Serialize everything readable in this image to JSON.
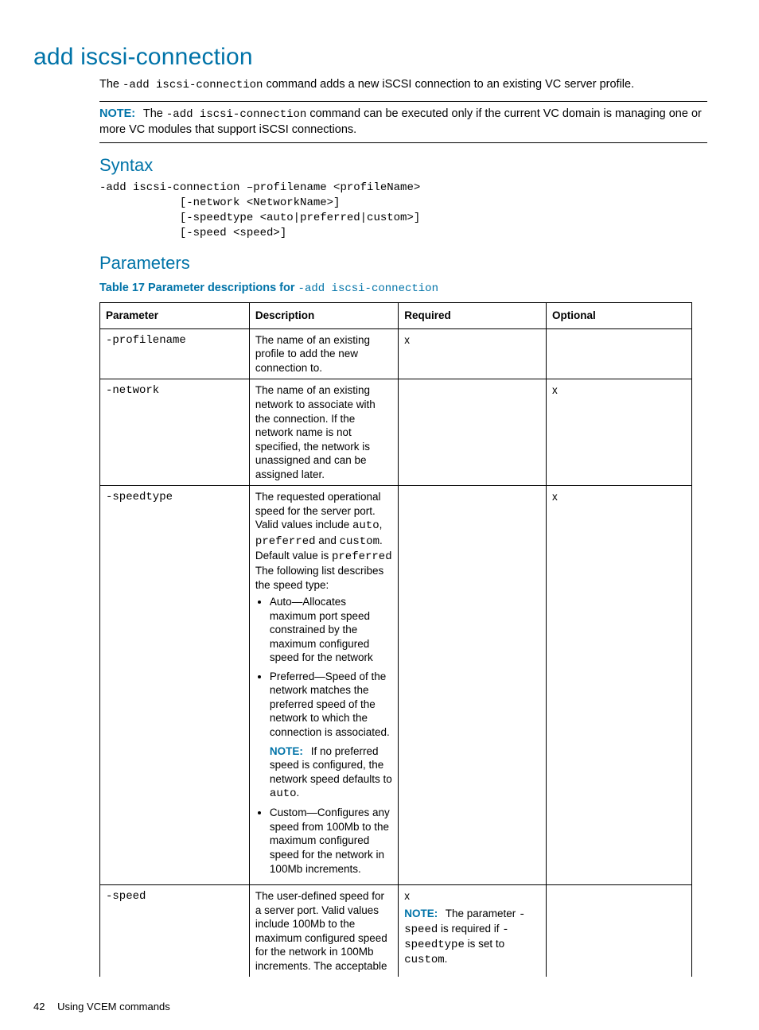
{
  "title": "add iscsi-connection",
  "intro_pre": "The ",
  "intro_code": "-add iscsi-connection",
  "intro_post": " command adds a new iSCSI connection to an existing VC server profile.",
  "note": {
    "label": "NOTE:",
    "pre": "The ",
    "code": "-add iscsi-connection",
    "post": " command can be executed only if the current VC domain is managing one or more VC modules that support iSCSI connections."
  },
  "syntax": {
    "heading": "Syntax",
    "lines": "-add iscsi-connection –profilename <profileName>\n            [-network <NetworkName>]\n            [-speedtype <auto|preferred|custom>]\n            [-speed <speed>]"
  },
  "parameters": {
    "heading": "Parameters",
    "caption_pre": "Table 17 Parameter descriptions for ",
    "caption_code": "-add iscsi-connection",
    "headers": {
      "parameter": "Parameter",
      "description": "Description",
      "required": "Required",
      "optional": "Optional"
    },
    "rows": {
      "profilename": {
        "param": "-profilename",
        "desc": "The name of an existing profile to add the new connection to.",
        "required": "x",
        "optional": ""
      },
      "network": {
        "param": "-network",
        "desc": "The name of an existing network to associate with the connection. If the network name is not specified, the network is unassigned and can be assigned later.",
        "required": "",
        "optional": "x"
      },
      "speedtype": {
        "param": "-speedtype",
        "desc_intro_pre": "The requested operational speed for the server port. Valid values include ",
        "desc_intro_codes_auto": "auto",
        "desc_intro_sep1": ", ",
        "desc_intro_codes_preferred": "preferred",
        "desc_intro_sep2": " and ",
        "desc_intro_codes_custom": "custom",
        "desc_intro_post1": ". Default value is ",
        "desc_default_code": "preferred",
        "desc_intro_post2": " The following list describes the speed type:",
        "bullets": {
          "auto": "Auto—Allocates maximum port speed constrained by the maximum configured speed for the network",
          "preferred": "Preferred—Speed of the network matches the preferred speed of the network to which the connection is associated.",
          "preferred_note_label": "NOTE:",
          "preferred_note_pre": "If no preferred speed is configured, the network speed defaults to ",
          "preferred_note_code": "auto",
          "preferred_note_post": ".",
          "custom": "Custom—Configures any speed from 100Mb to the maximum configured speed for the network in 100Mb increments."
        },
        "required": "",
        "optional": "x"
      },
      "speed": {
        "param": "-speed",
        "desc": "The user-defined speed for a server port. Valid values include 100Mb to the maximum configured speed for the network in 100Mb increments. The acceptable",
        "required": "x",
        "req_note_label": "NOTE:",
        "req_note_pre": "The parameter ",
        "req_note_code1": "-speed",
        "req_note_mid": " is required if ",
        "req_note_code2": "-speedtype",
        "req_note_mid2": " is set to ",
        "req_note_code3": "custom",
        "req_note_post": ".",
        "optional": ""
      }
    }
  },
  "footer": {
    "page": "42",
    "section": "Using VCEM commands"
  }
}
